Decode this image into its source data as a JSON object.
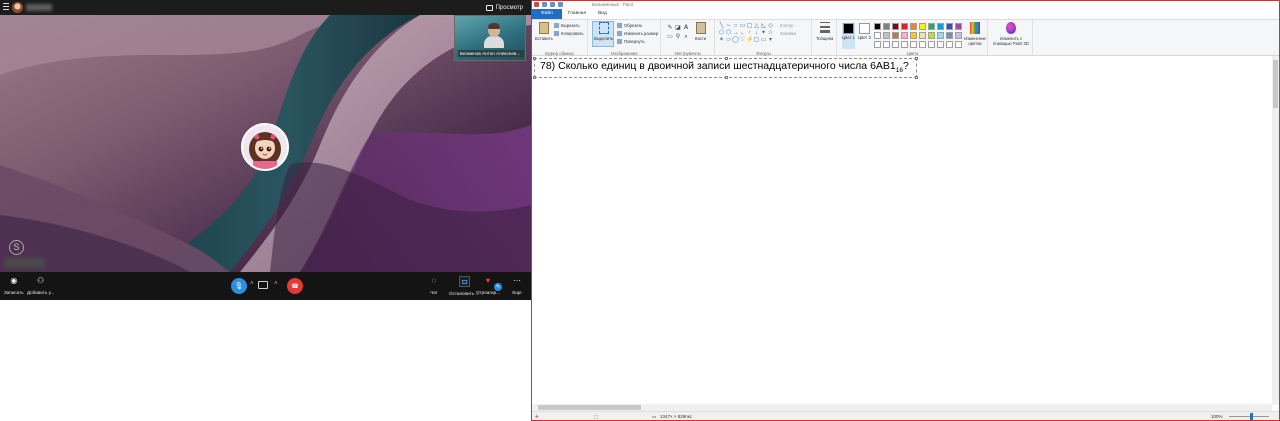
{
  "call": {
    "preview_label": "Просмотр",
    "self_view_name": "Безменов Антон Алексеев...",
    "controls": {
      "record": "Записать",
      "add_people": "Добавить у...",
      "chat": "Чат",
      "stop_share": "Остановить ...",
      "react": "Отреагир...",
      "more": "Еще"
    },
    "colors": {
      "mic": "#2b8fe0",
      "end_call": "#e53935"
    }
  },
  "paint": {
    "window_title": "Безымянный - Paint",
    "tabs": [
      "Файл",
      "Главная",
      "Вид"
    ],
    "ribbon": {
      "clipboard": {
        "paste": "Вставить",
        "cut": "Вырезать",
        "copy": "Копировать",
        "group": "Буфер обмена"
      },
      "image": {
        "select": "Выделить",
        "crop": "Обрезать",
        "resize": "Изменить размер",
        "rotate": "Повернуть",
        "group": "Изображение"
      },
      "tools": {
        "group": "Инструменты",
        "brushes": "Кисти"
      },
      "shapes": {
        "outline": "Контур",
        "fill": "Заливка",
        "group": "Фигуры"
      },
      "size": "Толщина",
      "colors": {
        "color1": "Цвет 1",
        "color2": "Цвет 2",
        "edit": "Изменение цветов",
        "group": "Цвета",
        "paint3d": "Изменить с помощью Paint 3D"
      }
    },
    "palette": [
      "#000000",
      "#7f7f7f",
      "#880015",
      "#ed1c24",
      "#ff7f27",
      "#fff200",
      "#22b14c",
      "#00a2e8",
      "#3f48cc",
      "#a349a4",
      "#ffffff",
      "#c3c3c3",
      "#b97a57",
      "#ffaec9",
      "#ffc90e",
      "#efe4b0",
      "#b5e61d",
      "#99d9ea",
      "#7092be",
      "#c8bfe7",
      "#ffffff",
      "#ffffff",
      "#ffffff",
      "#ffffff",
      "#ffffff",
      "#ffffff",
      "#ffffff",
      "#ffffff",
      "#ffffff",
      "#ffffff"
    ],
    "question": {
      "number": "78)",
      "text": "Сколько единиц в двоичной записи шестнадцатеричного числа 6AB1",
      "subscript": "16",
      "suffix": "?"
    },
    "status": {
      "dimensions": "1347× × 829пкс",
      "zoom": "100%"
    }
  }
}
